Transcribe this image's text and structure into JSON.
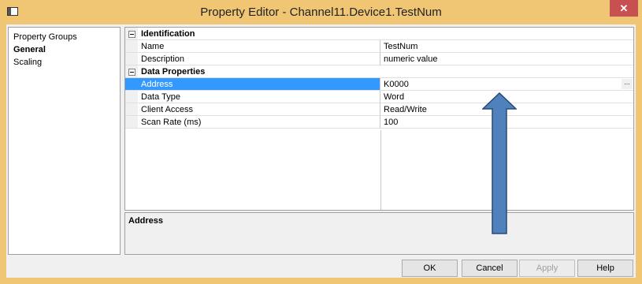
{
  "window": {
    "title": "Property Editor - Channel11.Device1.TestNum",
    "close_glyph": "✕"
  },
  "groups": {
    "header": "Property Groups",
    "items": [
      {
        "label": "General",
        "selected": true
      },
      {
        "label": "Scaling",
        "selected": false
      }
    ]
  },
  "grid": {
    "categories": [
      {
        "label": "Identification",
        "rows": [
          {
            "name": "Name",
            "value": "TestNum"
          },
          {
            "name": "Description",
            "value": "numeric value"
          }
        ]
      },
      {
        "label": "Data Properties",
        "rows": [
          {
            "name": "Address",
            "value": "K0000",
            "selected": true,
            "ellipsis": "..."
          },
          {
            "name": "Data Type",
            "value": "Word"
          },
          {
            "name": "Client Access",
            "value": "Read/Write"
          },
          {
            "name": "Scan Rate (ms)",
            "value": "100"
          }
        ]
      }
    ]
  },
  "description": {
    "title": "Address"
  },
  "buttons": {
    "ok": "OK",
    "cancel": "Cancel",
    "apply": "Apply",
    "help": "Help"
  },
  "colors": {
    "titlebar": "#f0c674",
    "selection": "#3399ff",
    "close": "#c75050",
    "arrow_fill": "#4f81bd",
    "arrow_stroke": "#2a4a75"
  }
}
